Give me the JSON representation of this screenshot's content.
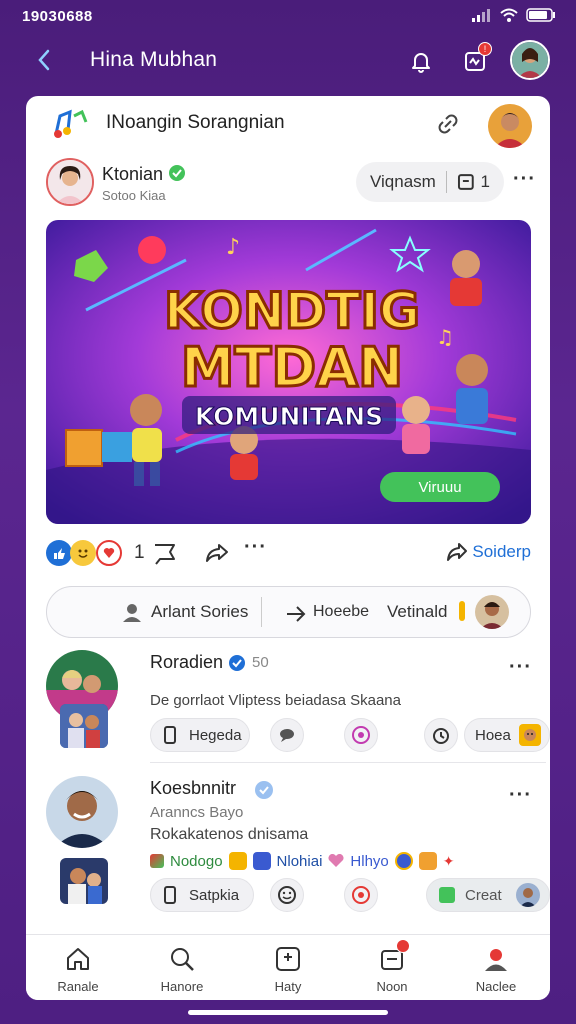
{
  "status": {
    "time": "19030688"
  },
  "header": {
    "title": "Hina Mubhan",
    "notif_count": "!"
  },
  "community": {
    "name": "INoangin Sorangnian"
  },
  "post": {
    "author_name": "Ktonian",
    "author_sub": "Sotoo Kiaa",
    "follow_label": "Viqnasm",
    "follow_count": "1",
    "banner_line1": "KONDTIG",
    "banner_line2": "MTDAN",
    "banner_line3": "KOMUNITANS",
    "banner_cta": "Viruuu",
    "reaction_count": "1",
    "share_label": "Soiderp"
  },
  "comment_bar": {
    "item1": "Arlant Sories",
    "item2": "Hoeebe",
    "item3": "Vetinald"
  },
  "comments": [
    {
      "name": "Roradien",
      "tag": "50",
      "text": "De gorrlaot Vliptess beiadasa Skaana",
      "chip1": "Hegeda",
      "chip2": "Hoea"
    },
    {
      "name": "Koesbnnitr",
      "sub": "Aranncs Bayo",
      "text": "Rokakatenos dnisama",
      "tag1": "Nodogo",
      "tag2": "Nlohiai",
      "tag3": "Hlhyo",
      "chip1": "Satpkia",
      "chip2": "Creat"
    }
  ],
  "nav": [
    {
      "label": "Ranale"
    },
    {
      "label": "Hanore"
    },
    {
      "label": "Haty"
    },
    {
      "label": "Noon"
    },
    {
      "label": "Naclee"
    }
  ],
  "colors": {
    "bg": "#4e1f82",
    "accent_green": "#43c25a",
    "accent_blue": "#1f6fd6",
    "badge_red": "#e53935"
  }
}
